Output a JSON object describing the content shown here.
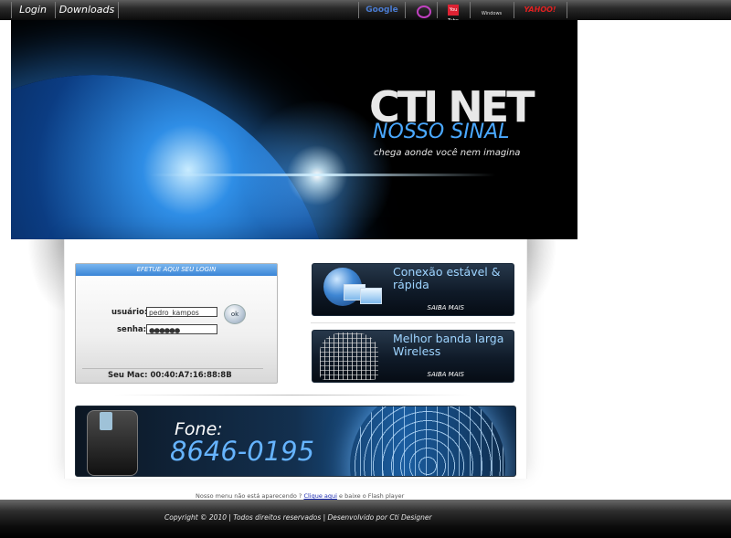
{
  "nav": {
    "links": [
      "Login",
      "Downloads"
    ],
    "external": [
      {
        "label": "Google",
        "icon": "google-icon"
      },
      {
        "label": "",
        "icon": "orkut-icon"
      },
      {
        "label": "You Tube",
        "icon": "youtube-icon"
      },
      {
        "label": "Windows Live",
        "icon": "windows-live-icon"
      },
      {
        "label": "YAHOO!",
        "icon": "yahoo-icon"
      }
    ]
  },
  "banner": {
    "brand": "CTI NET",
    "slogan": "NOSSO SINAL",
    "tagline": "chega aonde você nem imagina"
  },
  "login": {
    "header": "EFETUE AQUI SEU LOGIN",
    "user_label": "usuário:",
    "user_value": "pedro_kampos",
    "pass_label": "senha:",
    "pass_value": "●●●●●●",
    "ok_label": "ok",
    "mac": "Seu Mac: 00:40:A7:16:88:8B"
  },
  "cards": [
    {
      "title": "Conexão estável & rápida",
      "more": "SAIBA MAIS"
    },
    {
      "title": "Melhor banda larga Wireless",
      "more": "SAIBA MAIS"
    }
  ],
  "phone": {
    "label": "Fone:",
    "number": "8646-0195"
  },
  "notice": {
    "pre": "Nosso menu não está aparecendo ?",
    "link": "Clique aqui",
    "post": "e baixe o Flash player"
  },
  "footer": {
    "copyright": "Copyright © 2010 | Todos direitos reservados | Desenvolvido por Cti Designer"
  },
  "colors": {
    "accent": "#4aa8ff",
    "login_header": "#3a84d6",
    "card_bg": "#0f1a28",
    "footer_bg": "#0c0c0c"
  }
}
